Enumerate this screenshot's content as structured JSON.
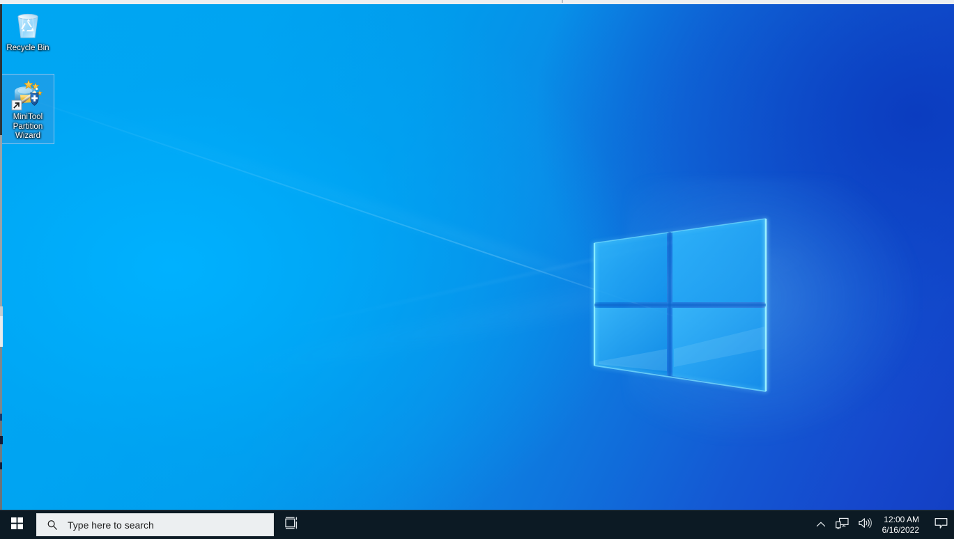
{
  "desktop": {
    "wallpaper_name": "windows-10-hero-light-blue",
    "colors": {
      "wallpaper_left": "#00A7F2",
      "wallpaper_right": "#1340C4",
      "taskbar_bg": "#0C1A24",
      "search_bg": "#ECEFF1",
      "selection_fill": "#3C96DC",
      "selection_border": "#A0CDF0",
      "text_white": "#FFFFFF"
    },
    "icons": [
      {
        "label": "Recycle Bin",
        "icon": "recycle-bin-icon",
        "selected": false
      },
      {
        "label": "MiniTool Partition Wizard",
        "icon": "minitool-partition-wizard-icon",
        "selected": true,
        "is_shortcut": true
      }
    ]
  },
  "taskbar": {
    "start": {
      "label": "Start",
      "icon": "windows-logo-icon"
    },
    "search": {
      "placeholder": "Type here to search",
      "value": "",
      "icon": "search-icon"
    },
    "task_view": {
      "label": "Task View",
      "icon": "task-view-icon"
    },
    "tray": {
      "show_hidden": {
        "label": "Show hidden icons",
        "icon": "chevron-up-icon"
      },
      "network": {
        "label": "Network",
        "icon": "network-icon"
      },
      "volume": {
        "label": "Speakers",
        "icon": "volume-icon"
      },
      "clock": {
        "time": "12:00 AM",
        "date": "6/16/2022"
      },
      "notifications": {
        "label": "Notifications",
        "icon": "notification-bubble-icon"
      }
    }
  }
}
